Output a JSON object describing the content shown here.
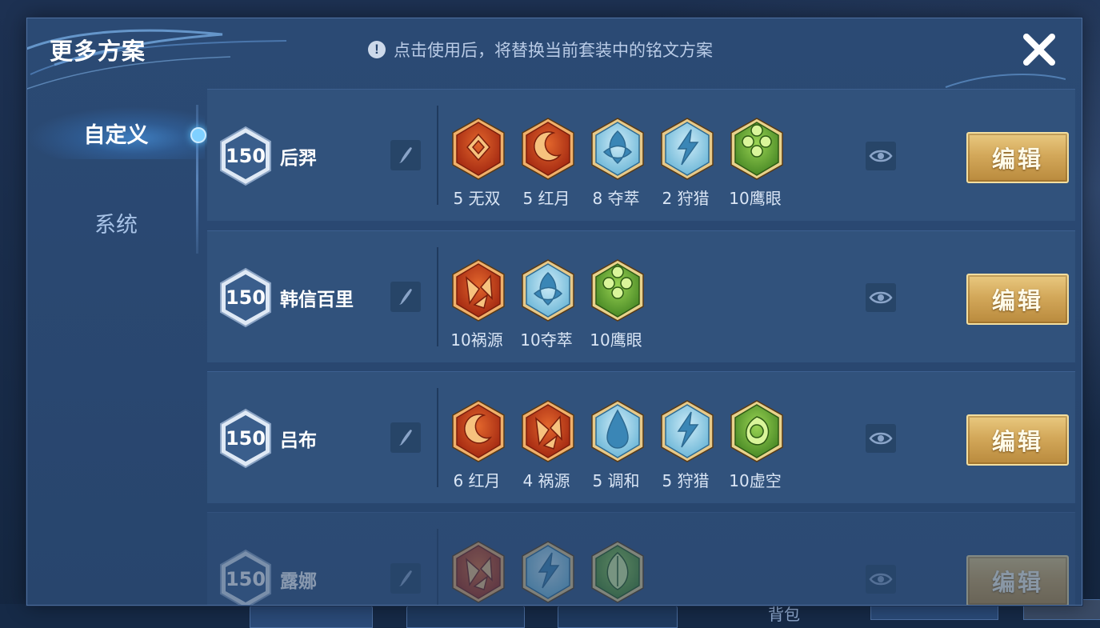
{
  "dialog": {
    "title": "更多方案",
    "notice": "点击使用后，将替换当前套装中的铭文方案",
    "notice_icon": "exclamation-icon",
    "close_icon": "close-icon"
  },
  "sidebar": {
    "tabs": [
      {
        "label": "自定义",
        "active": true
      },
      {
        "label": "系统",
        "active": false
      }
    ]
  },
  "background": {
    "bottom_labels": [
      "背包"
    ]
  },
  "colors": {
    "panel": "#2b4a74",
    "row": "#31527c",
    "edit_button": "#d3a85a",
    "red_rune": "#c9401c",
    "blue_rune": "#8ed0ea",
    "green_rune": "#6aa83a"
  },
  "plans": [
    {
      "level": "150",
      "hero": "后羿",
      "edit_label": "编辑",
      "runes": [
        {
          "color": "red",
          "symbol": "diamond",
          "label": "5 无双"
        },
        {
          "color": "red",
          "symbol": "moon",
          "label": "5 红月"
        },
        {
          "color": "blue",
          "symbol": "knot",
          "label": "8 夺萃"
        },
        {
          "color": "blue",
          "symbol": "bolt",
          "label": "2 狩猎"
        },
        {
          "color": "green",
          "symbol": "clover",
          "label": "10鹰眼"
        }
      ]
    },
    {
      "level": "150",
      "hero": "韩信百里",
      "edit_label": "编辑",
      "runes": [
        {
          "color": "red",
          "symbol": "shards",
          "label": "10祸源"
        },
        {
          "color": "blue",
          "symbol": "knot",
          "label": "10夺萃"
        },
        {
          "color": "green",
          "symbol": "clover",
          "label": "10鹰眼"
        }
      ]
    },
    {
      "level": "150",
      "hero": "吕布",
      "edit_label": "编辑",
      "runes": [
        {
          "color": "red",
          "symbol": "moon",
          "label": "6 红月"
        },
        {
          "color": "red",
          "symbol": "shards",
          "label": "4 祸源"
        },
        {
          "color": "blue",
          "symbol": "drop",
          "label": "5 调和"
        },
        {
          "color": "blue",
          "symbol": "bolt",
          "label": "5 狩猎"
        },
        {
          "color": "green",
          "symbol": "void",
          "label": "10虚空"
        }
      ]
    },
    {
      "level": "150",
      "hero": "露娜",
      "edit_label": "编辑",
      "runes": [
        {
          "color": "red",
          "symbol": "shards",
          "label": ""
        },
        {
          "color": "blue",
          "symbol": "bolt",
          "label": ""
        },
        {
          "color": "green",
          "symbol": "leaf",
          "label": ""
        }
      ]
    }
  ]
}
